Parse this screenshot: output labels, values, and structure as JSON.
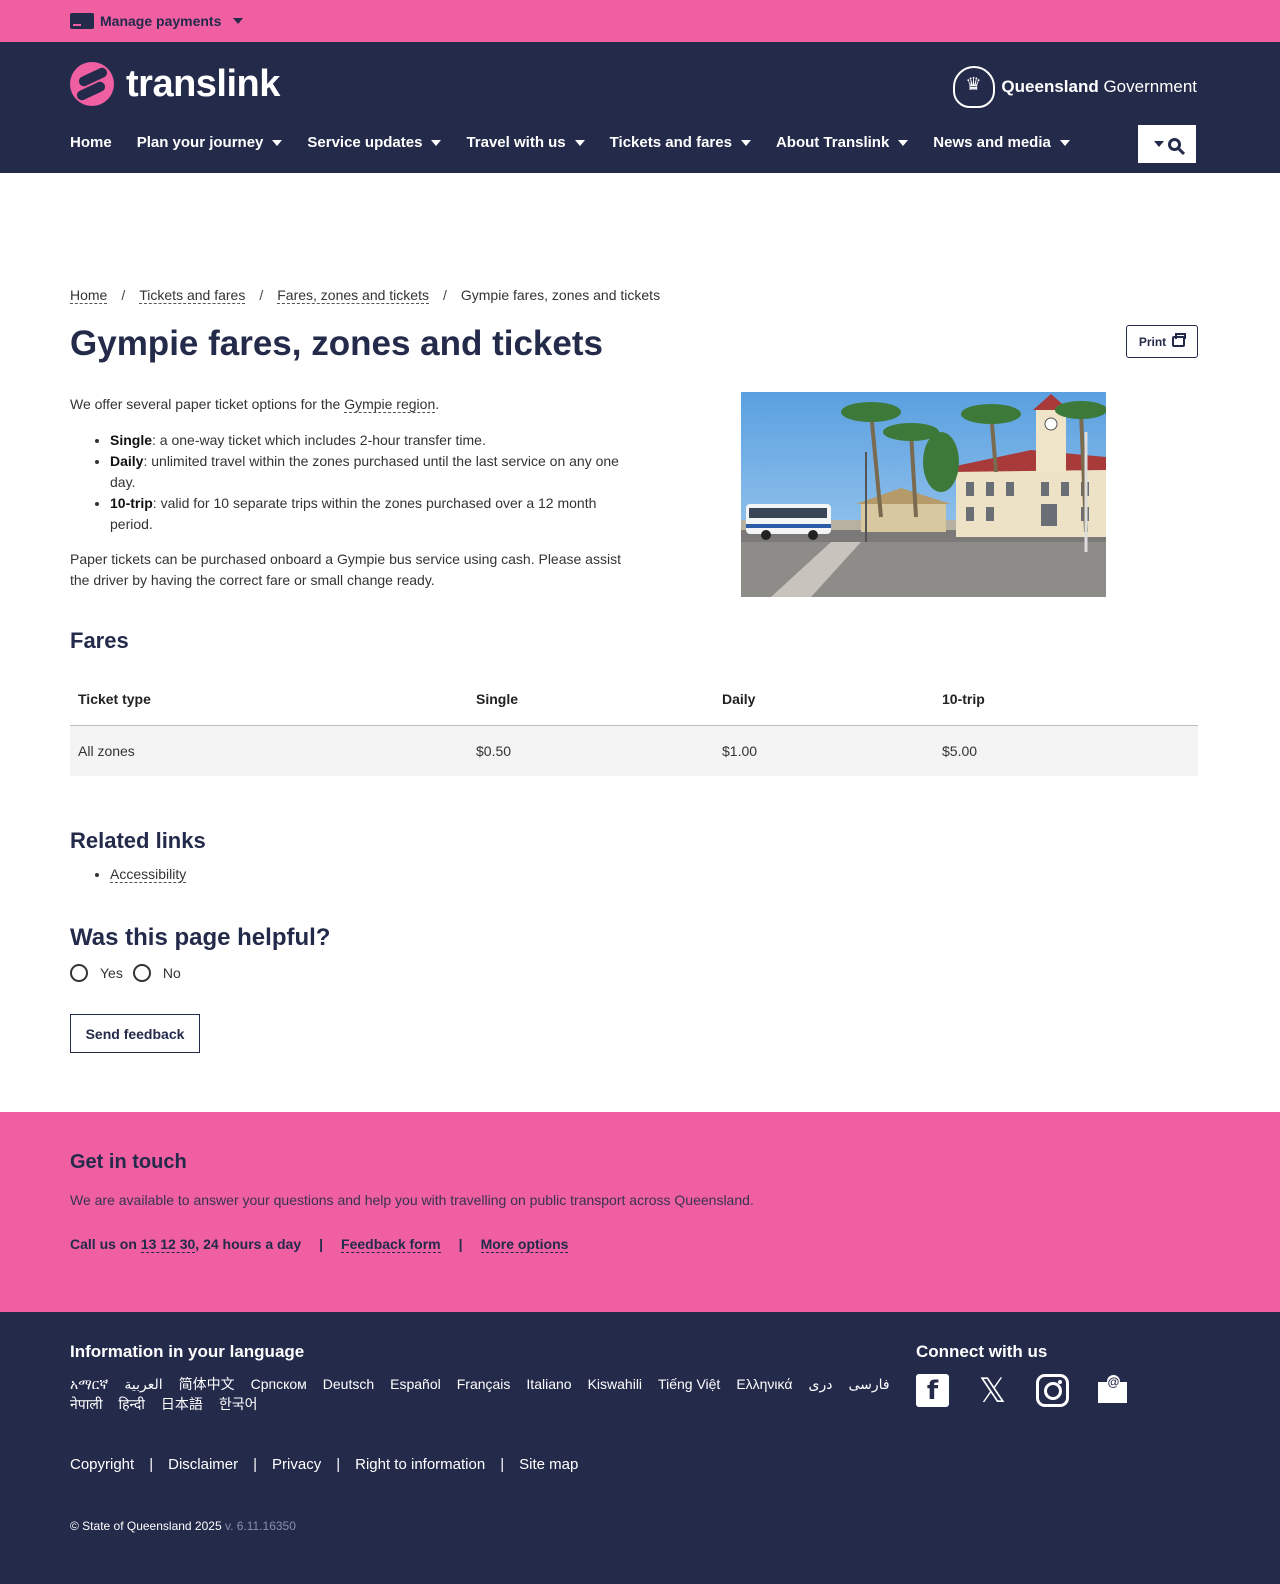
{
  "topbar": {
    "manage_payments": "Manage payments"
  },
  "header": {
    "logo_text": "translink",
    "qgov_bold": "Queensland",
    "qgov_rest": " Government",
    "nav": [
      {
        "label": "Home"
      },
      {
        "label": "Plan your journey"
      },
      {
        "label": "Service updates"
      },
      {
        "label": "Travel with us"
      },
      {
        "label": "Tickets and fares"
      },
      {
        "label": "About Translink"
      },
      {
        "label": "News and media"
      }
    ]
  },
  "breadcrumb": {
    "items": [
      "Home",
      "Tickets and fares",
      "Fares, zones and tickets",
      "Gympie fares, zones and tickets"
    ],
    "separator": "/"
  },
  "page": {
    "title": "Gympie fares, zones and tickets",
    "print_label": "Print",
    "intro_pre": "We offer several paper ticket options for the ",
    "intro_link": "Gympie region",
    "intro_post": ".",
    "bullets": [
      {
        "term": "Single",
        "text": ": a one-way ticket which includes 2-hour transfer time."
      },
      {
        "term": "Daily",
        "text": ": unlimited travel within the zones purchased until the last service on any one day."
      },
      {
        "term": "10-trip",
        "text": ": valid for 10 separate trips within the zones purchased over a 12 month period."
      }
    ],
    "paper_note": "Paper tickets can be purchased onboard a Gympie bus service using cash. Please assist the driver by having the correct fare or small change ready."
  },
  "fares": {
    "title": "Fares",
    "headers": [
      "Ticket type",
      "Single",
      "Daily",
      "10-trip"
    ],
    "rows": [
      [
        "All zones",
        "$0.50",
        "$1.00",
        "$5.00"
      ]
    ]
  },
  "related": {
    "title": "Related links",
    "links": [
      "Accessibility"
    ]
  },
  "feedback": {
    "title": "Was this page helpful?",
    "yes": "Yes",
    "no": "No",
    "send": "Send feedback"
  },
  "touch": {
    "title": "Get in touch",
    "text": "We are available to answer your questions and help you with travelling on public transport across Queensland.",
    "call_pre": "Call us on ",
    "phone": "13 12 30",
    "call_post": ", 24 hours a day",
    "sep": "|",
    "feedback_form": "Feedback form",
    "more_options": "More options"
  },
  "footer": {
    "lang_title": "Information in your language",
    "languages": [
      "አማርኛ",
      "العربية",
      "简体中文",
      "Српском",
      "Deutsch",
      "Español",
      "Français",
      "Italiano",
      "Kiswahili",
      "Tiếng Việt",
      "Ελληνικά",
      "دری",
      "فارسی",
      "नेपाली",
      "हिन्दी",
      "日本語",
      "한국어"
    ],
    "connect_title": "Connect with us",
    "links": [
      "Copyright",
      "Disclaimer",
      "Privacy",
      "Right to information",
      "Site map"
    ],
    "link_sep": "|",
    "copyright": "© State of Queensland 2025",
    "version": " v. 6.11.16350"
  },
  "colors": {
    "pink": "#ef5fa2",
    "navy": "#232a4a"
  }
}
